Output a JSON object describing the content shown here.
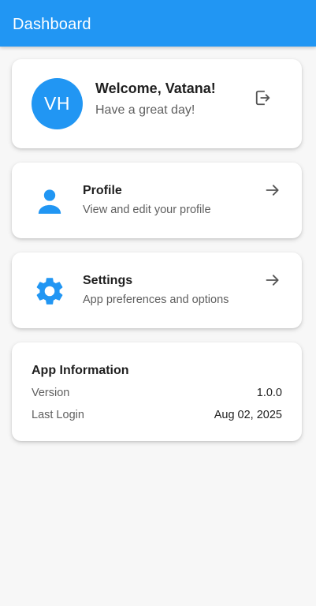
{
  "appbar": {
    "title": "Dashboard"
  },
  "welcome": {
    "initials": "VH",
    "greeting": "Welcome, Vatana!",
    "subtitle": "Have a great day!"
  },
  "menu": [
    {
      "title": "Profile",
      "subtitle": "View and edit your profile",
      "icon": "person-icon"
    },
    {
      "title": "Settings",
      "subtitle": "App preferences and options",
      "icon": "gear-icon"
    }
  ],
  "info": {
    "title": "App Information",
    "rows": [
      {
        "label": "Version",
        "value": "1.0.0"
      },
      {
        "label": "Last Login",
        "value": "Aug 02, 2025"
      }
    ]
  },
  "colors": {
    "primary": "#2196f3",
    "background": "#f7f7f7",
    "card": "#ffffff",
    "text_primary": "#1f1f1f",
    "text_secondary": "#5f5f5f"
  }
}
